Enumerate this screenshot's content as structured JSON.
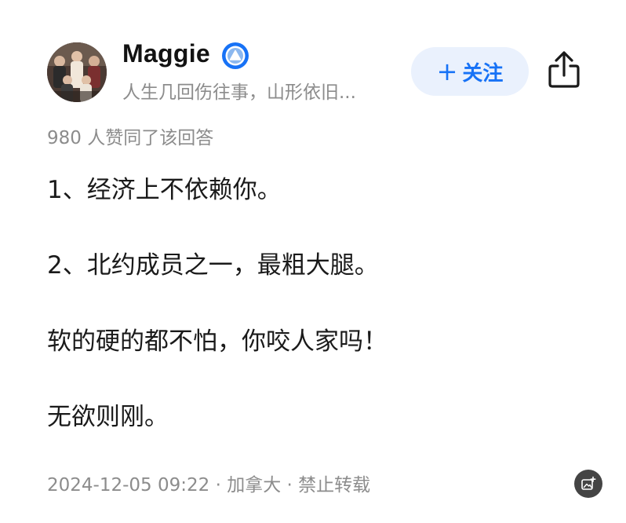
{
  "author": {
    "name": "Maggie",
    "bio": "人生几回伤往事，山形依旧...",
    "verified_badge": "verified-triangle-icon",
    "accent_color": "#1772f6"
  },
  "actions": {
    "follow_plus": "+",
    "follow_label": "关注",
    "share_icon": "share-icon"
  },
  "stats": {
    "likes_text": "980 人赞同了该回答"
  },
  "content": {
    "paragraphs": [
      "1、经济上不依赖你。",
      "2、北约成员之一，最粗大腿。",
      "软的硬的都不怕，你咬人家吗！",
      "无欲则刚。"
    ]
  },
  "footer": {
    "meta": "2024-12-05 09:22 · 加拿大 · 禁止转载",
    "image_edit_icon": "image-edit-icon"
  }
}
